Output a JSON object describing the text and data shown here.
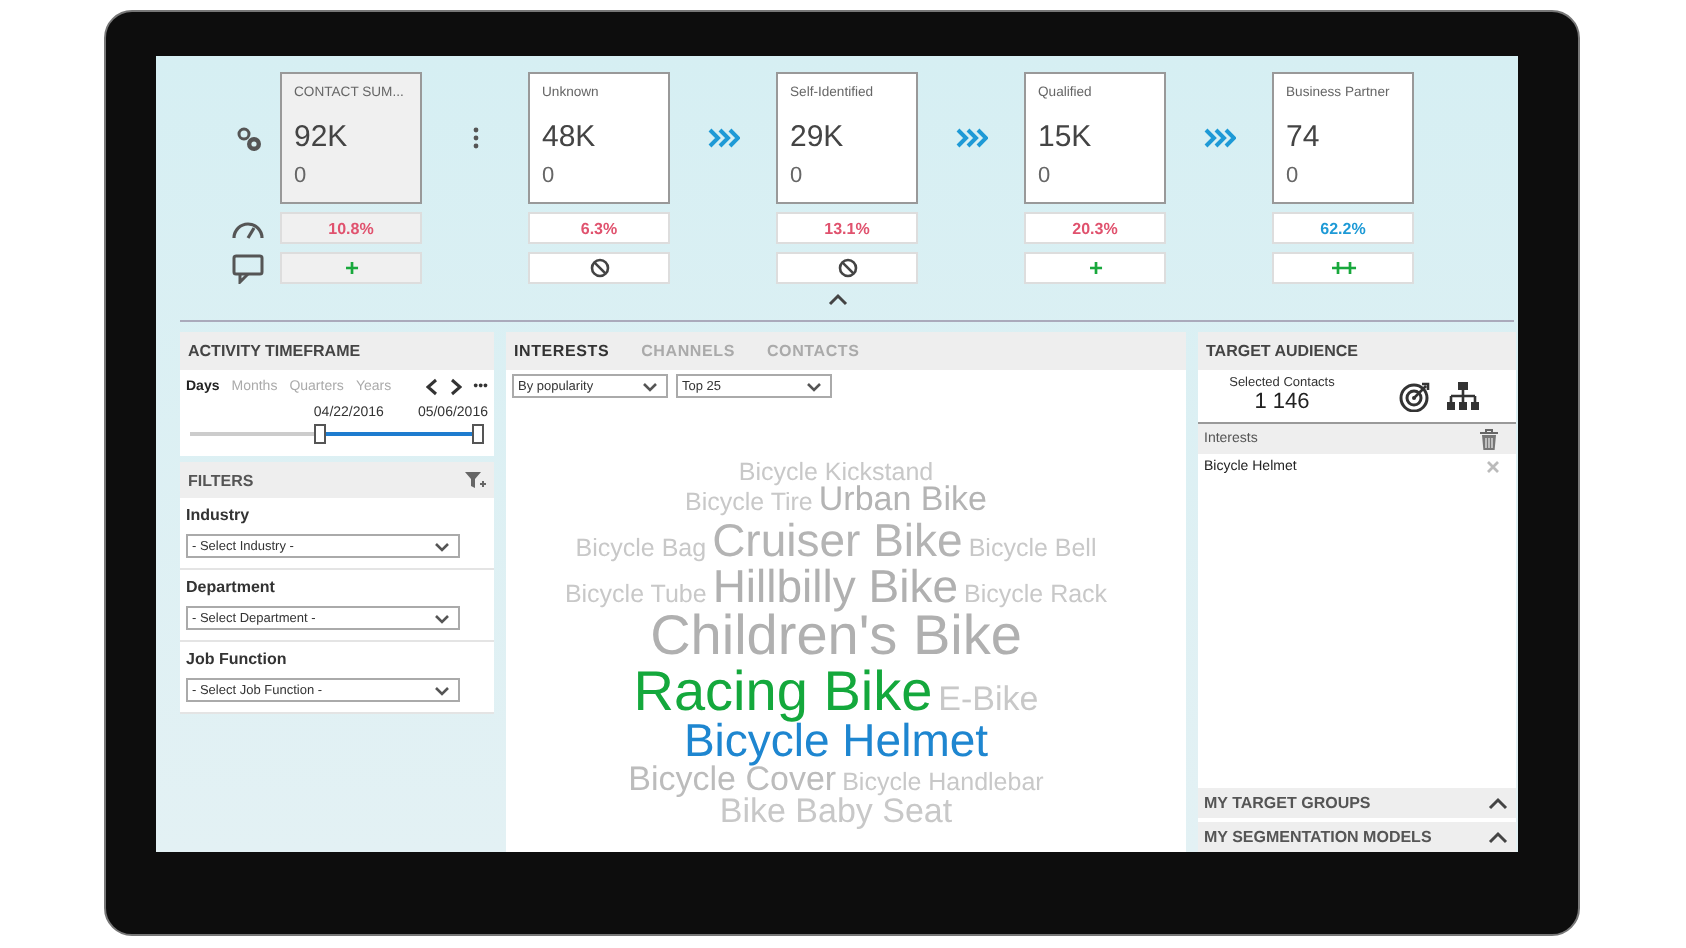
{
  "stages": [
    {
      "title": "CONTACT SUM...",
      "value": "92K",
      "sub": "0",
      "selected": true,
      "rate": "10.8%",
      "color": "#e0526e",
      "action": {
        "kind": "text",
        "text": "+"
      }
    },
    {
      "title": "Unknown",
      "value": "48K",
      "sub": "0",
      "selected": false,
      "rate": "6.3%",
      "color": "#e0526e",
      "action": {
        "kind": "blocked"
      }
    },
    {
      "title": "Self-Identified",
      "value": "29K",
      "sub": "0",
      "selected": false,
      "rate": "13.1%",
      "color": "#e0526e",
      "action": {
        "kind": "blocked"
      }
    },
    {
      "title": "Qualified",
      "value": "15K",
      "sub": "0",
      "selected": false,
      "rate": "20.3%",
      "color": "#e0526e",
      "action": {
        "kind": "text",
        "text": "+"
      }
    },
    {
      "title": "Business Partner",
      "value": "74",
      "sub": "0",
      "selected": false,
      "rate": "62.2%",
      "color": "#1e9ad6",
      "action": {
        "kind": "text",
        "text": "++"
      }
    }
  ],
  "connectors": [
    {
      "kind": "more"
    },
    {
      "kind": "flow"
    },
    {
      "kind": "flow"
    },
    {
      "kind": "flow"
    }
  ],
  "timeframe": {
    "title": "ACTIVITY TIMEFRAME",
    "tabs": [
      {
        "label": "Days",
        "selected": true
      },
      {
        "label": "Months",
        "selected": false
      },
      {
        "label": "Quarters",
        "selected": false
      },
      {
        "label": "Years",
        "selected": false
      }
    ],
    "more": "•••",
    "start": "04/22/2016",
    "end": "05/06/2016",
    "range": {
      "level": 0.55
    }
  },
  "filters": {
    "title": "FILTERS",
    "groups": [
      {
        "label": "Industry",
        "placeholder": "- Select Industry -"
      },
      {
        "label": "Department",
        "placeholder": "- Select Department -"
      },
      {
        "label": "Job Function",
        "placeholder": "- Select Job Function -"
      }
    ]
  },
  "analysis": {
    "tabs": [
      {
        "label": "INTERESTS",
        "selected": true
      },
      {
        "label": "CHANNELS",
        "selected": false
      },
      {
        "label": "CONTACTS",
        "selected": false
      }
    ],
    "sort": "By popularity",
    "limit": "Top 25",
    "cloud": [
      [
        {
          "text": "Bicycle Kickstand",
          "kind": "small",
          "color": "#c8c8c8"
        }
      ],
      [
        {
          "text": "Bicycle Tire",
          "kind": "small",
          "color": "#c8c8c8"
        },
        {
          "text": "Urban Bike",
          "kind": "medium",
          "color": "#b4b4b4"
        }
      ],
      [
        {
          "text": "Bicycle Bag",
          "kind": "small",
          "color": "#c8c8c8"
        },
        {
          "text": "Cruiser Bike",
          "kind": "large",
          "color": "#b4b4b4"
        },
        {
          "text": "Bicycle Bell",
          "kind": "small",
          "color": "#c8c8c8"
        }
      ],
      [
        {
          "text": "Bicycle Tube",
          "kind": "small",
          "color": "#c8c8c8"
        },
        {
          "text": "Hillbilly Bike",
          "kind": "large",
          "color": "#b0b0b0"
        },
        {
          "text": "Bicycle Rack",
          "kind": "small",
          "color": "#c8c8c8"
        }
      ],
      [
        {
          "text": "Children's Bike",
          "kind": "huge",
          "color": "#b0b0b0"
        }
      ],
      [
        {
          "text": "Racing Bike",
          "kind": "huge",
          "color": "#14a83c"
        },
        {
          "text": "E-Bike",
          "kind": "medium",
          "color": "#c8c8c8"
        }
      ],
      [
        {
          "text": "Bicycle Helmet",
          "kind": "large",
          "color": "#1e86d0"
        }
      ],
      [
        {
          "text": "Bicycle Cover",
          "kind": "medium",
          "color": "#bcbcbc"
        },
        {
          "text": "Bicycle Handlebar",
          "kind": "small",
          "color": "#c8c8c8"
        }
      ],
      [
        {
          "text": "Bike Baby Seat",
          "kind": "medium",
          "color": "#c8c8c8"
        }
      ]
    ]
  },
  "target": {
    "title": "TARGET AUDIENCE",
    "selected_label": "Selected Contacts",
    "selected_count": "1 146",
    "section": "Interests",
    "items": [
      "Bicycle Helmet"
    ],
    "footer": [
      {
        "label": "MY TARGET GROUPS",
        "expanded": false
      },
      {
        "label": "MY SEGMENTATION MODELS",
        "expanded": false
      }
    ]
  }
}
